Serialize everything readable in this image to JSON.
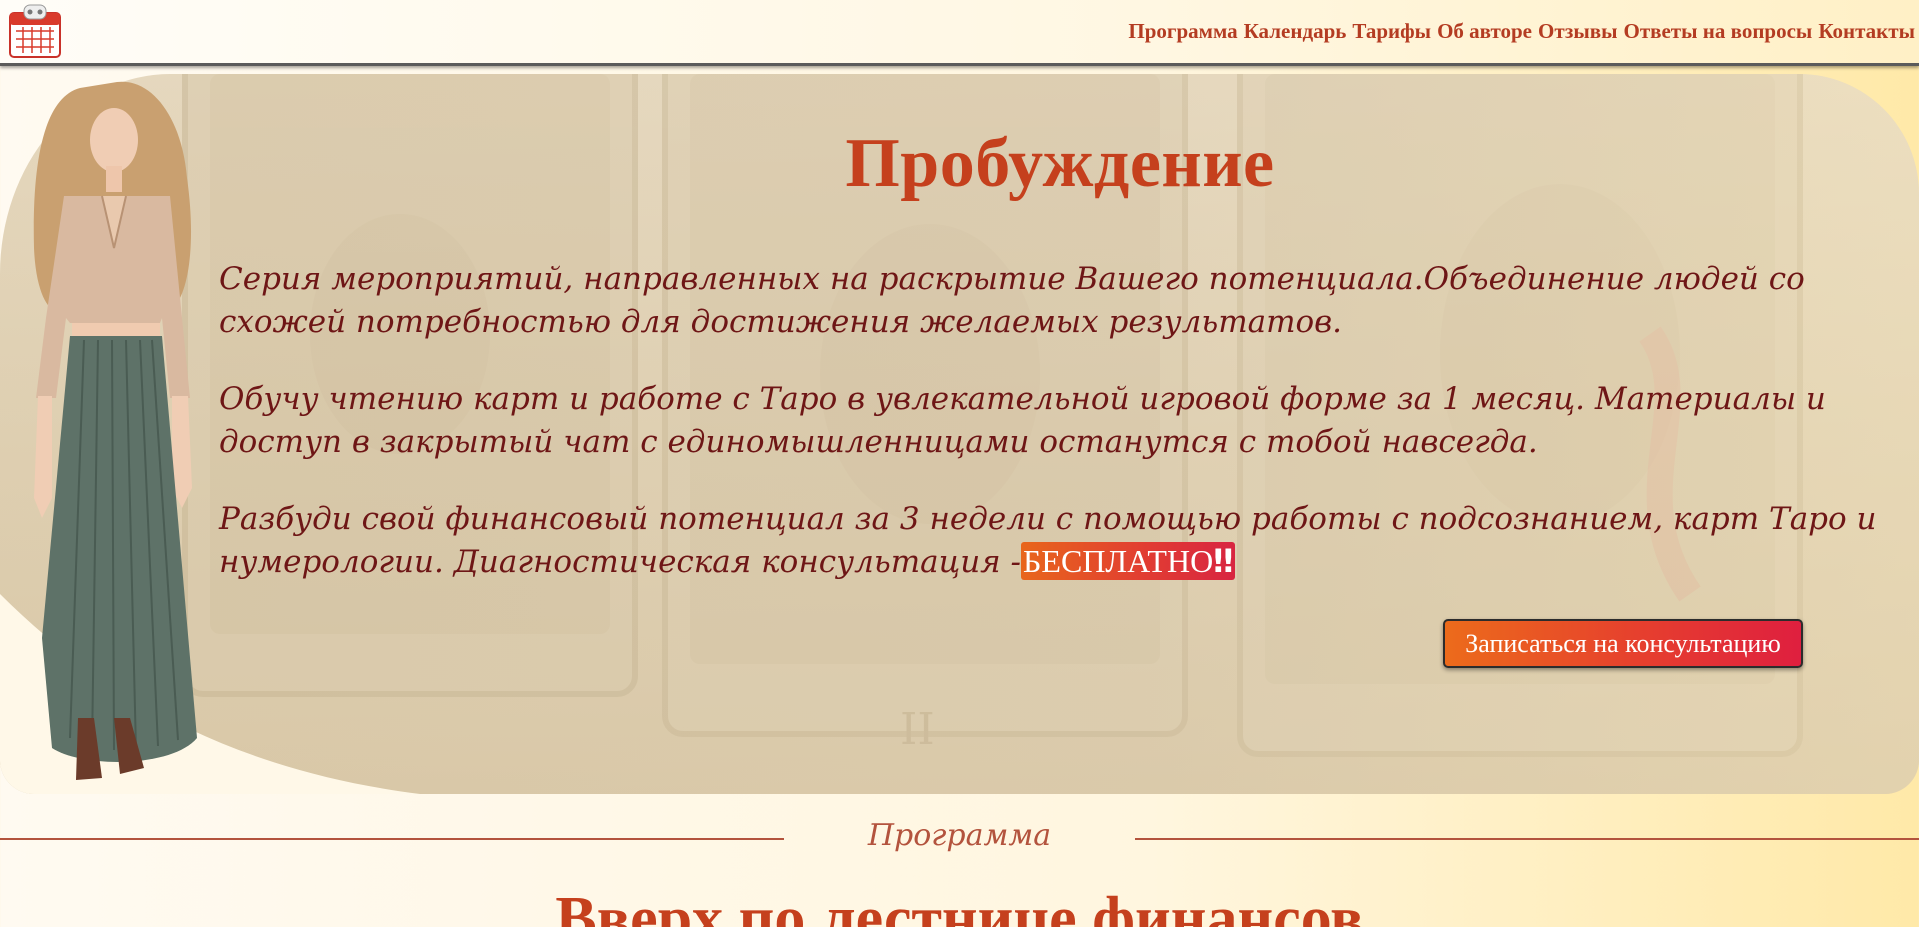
{
  "header": {
    "logo_icon": "calendar-icon",
    "nav": [
      {
        "label": "Программа"
      },
      {
        "label": "Календарь"
      },
      {
        "label": "Тарифы"
      },
      {
        "label": "Об авторе"
      },
      {
        "label": "Отзывы"
      },
      {
        "label": "Ответы на вопросы"
      },
      {
        "label": "Контакты"
      }
    ]
  },
  "hero": {
    "title": "Пробуждение",
    "paragraph1": "Серия мероприятий, направленных на раскрытие Вашего потенциала.Объединение людей со схожей потребностью для достижения желаемых результатов.",
    "paragraph2": "Обучу чтению карт и работе с Таро в увлекательной игровой форме за 1 месяц. Материалы и доступ в закрытый чат с единомышленницами останутся с тобой навсегда.",
    "paragraph3": "Разбуди свой финансовый потенциал за 3 недели с помощью работы с подсознанием, карт Таро и нумерологии. Диагностическая консультация -",
    "free_badge": "БЕСПЛАТНО",
    "free_badge_marks": "‼",
    "cta_label": "Записаться на консультацию"
  },
  "section": {
    "label": "Программа",
    "heading": "Вверх по лестнице финансов"
  },
  "colors": {
    "accent": "#c5401d",
    "text": "#6e1616",
    "nav": "#b43c22",
    "cta_start": "#ec6b1b",
    "cta_end": "#df1f3f"
  }
}
